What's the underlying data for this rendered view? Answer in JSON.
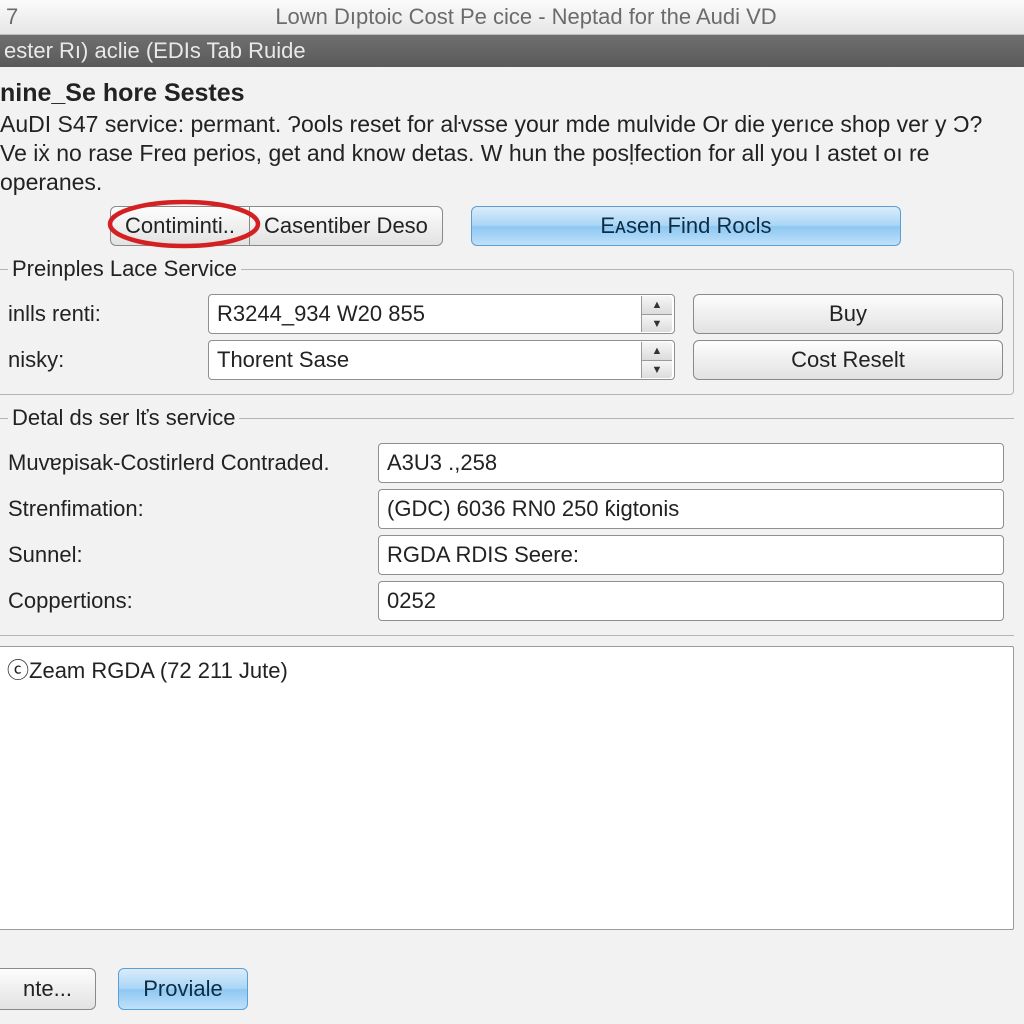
{
  "titlebar": {
    "left": "7",
    "center": "Lown Dıptoic Cost Pe cice - Neptad for the Audi VD"
  },
  "menubar": {
    "text": "ester Rı) aclie (EDIs Tab Ruide"
  },
  "heading": "nine_Se hore Sestes",
  "paragraph": "AuDI S47 service: permant. Ɂools reset for aŀvsse your mde mulvide Or die yerıce shop ver y Ɔ? Ve iẋ no rase Freɑ perios, get and know detas. W hun the posḷfection for all you I astet oı re operanes.",
  "buttons": {
    "contiminti": "Contiminti..",
    "casentiber": "Casentiber Deso",
    "easen": "Eᴀsen Find Rocls"
  },
  "group1": {
    "legend": "Preinples Lace Service",
    "row1_label": "inlls renti:",
    "row1_value": "R3244_934 W20 855",
    "row2_label": "nisky:",
    "row2_value": "Thorent Sase",
    "buy": "Buy",
    "cost": "Cost Reselt"
  },
  "group2": {
    "legend": "Detal ds ser lťs service",
    "r1_label": "Muvɐpisak-Costirlerd Contraded.",
    "r1_value": "A3U3 .,258",
    "r2_label": "Strenfimation:",
    "r2_value": "(GDC) 6036 RN0 250 ƙigtonis",
    "r3_label": "Sunnel:",
    "r3_value": "RGDA RDIS Seere:",
    "r4_label": "Coppertions:",
    "r4_value": "0252"
  },
  "list": {
    "item1": "Zeam RGDA (72 211 Jute)"
  },
  "bottom": {
    "nte": "nte...",
    "proviale": "Proviale"
  }
}
